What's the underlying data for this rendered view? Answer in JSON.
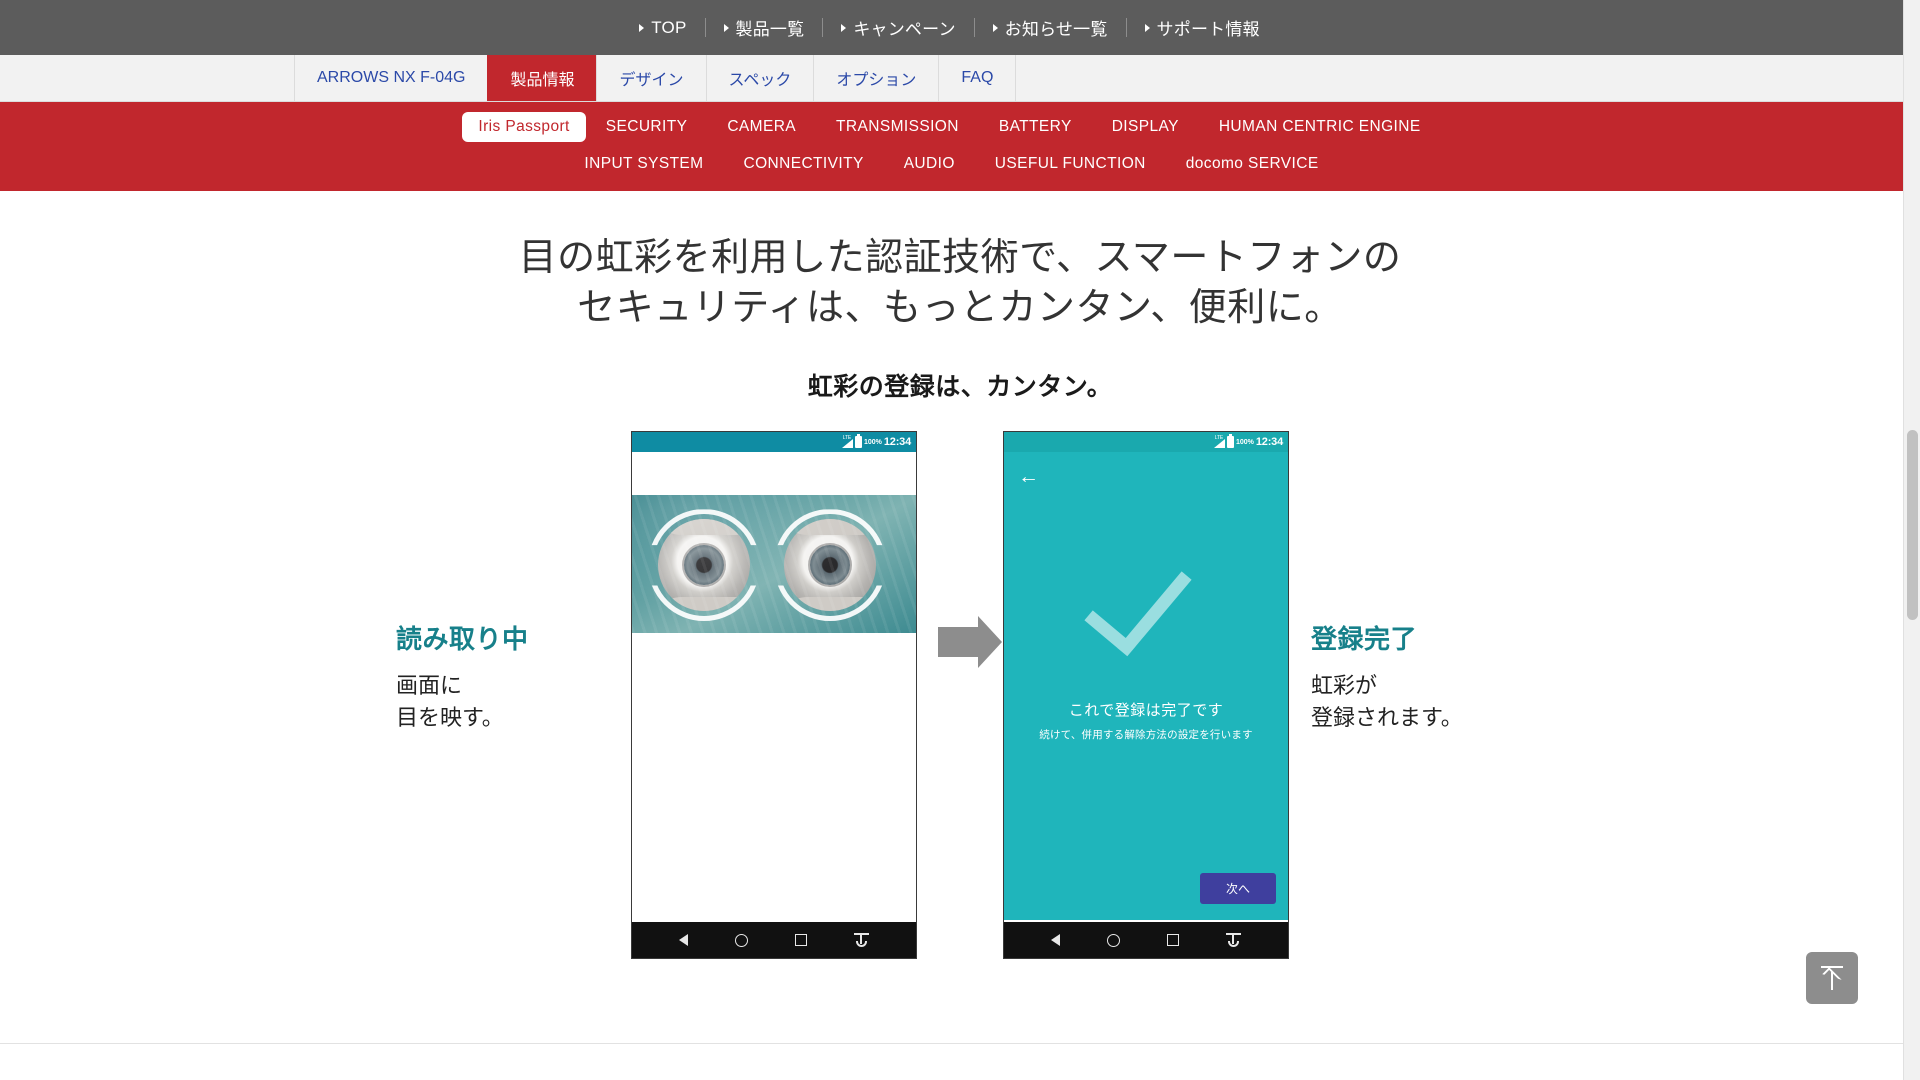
{
  "global_nav": {
    "items": [
      {
        "label": "TOP"
      },
      {
        "label": "製品一覧"
      },
      {
        "label": "キャンペーン"
      },
      {
        "label": "お知らせ一覧"
      },
      {
        "label": "サポート情報"
      }
    ]
  },
  "tabs": [
    {
      "label": "ARROWS NX F-04G",
      "active": false
    },
    {
      "label": "製品情報",
      "active": true
    },
    {
      "label": "デザイン",
      "active": false
    },
    {
      "label": "スペック",
      "active": false
    },
    {
      "label": "オプション",
      "active": false
    },
    {
      "label": "FAQ",
      "active": false
    }
  ],
  "section_nav": {
    "row1": [
      {
        "label": "Iris Passport",
        "current": true
      },
      {
        "label": "SECURITY",
        "current": false
      },
      {
        "label": "CAMERA",
        "current": false
      },
      {
        "label": "TRANSMISSION",
        "current": false
      },
      {
        "label": "BATTERY",
        "current": false
      },
      {
        "label": "DISPLAY",
        "current": false
      },
      {
        "label": "HUMAN CENTRIC ENGINE",
        "current": false
      }
    ],
    "row2": [
      {
        "label": "INPUT SYSTEM",
        "current": false
      },
      {
        "label": "CONNECTIVITY",
        "current": false
      },
      {
        "label": "AUDIO",
        "current": false
      },
      {
        "label": "USEFUL FUNCTION",
        "current": false
      },
      {
        "label": "docomo SERVICE",
        "current": false
      }
    ]
  },
  "main": {
    "headline_line1": "目の虹彩を利用した認証技術で、スマートフォンの",
    "headline_line2": "セキュリティは、もっとカンタン、便利に。",
    "subhead": "虹彩の登録は、カンタン。"
  },
  "steps": {
    "left": {
      "caption_title": "読み取り中",
      "caption_body": "画面に\n目を映す。",
      "status": {
        "network": "LTE",
        "battery": "100%",
        "time": "12:34"
      }
    },
    "right": {
      "caption_title": "登録完了",
      "caption_body": "虹彩が\n登録されます。",
      "status": {
        "network": "LTE",
        "battery": "100%",
        "time": "12:34"
      },
      "screen_message": "これで登録は完了です",
      "screen_sub": "続けて、併用する解除方法の設定を行います",
      "next_button": "次へ"
    }
  },
  "colors": {
    "brand_red": "#c1272d",
    "header_grey": "#5c5c5c",
    "teal_accent": "#17808a",
    "phone_teal": "#1fb5bb",
    "status_teal": "#0f8ca3",
    "link_blue": "#2b49a8",
    "next_button_purple": "#3f3f9e"
  }
}
